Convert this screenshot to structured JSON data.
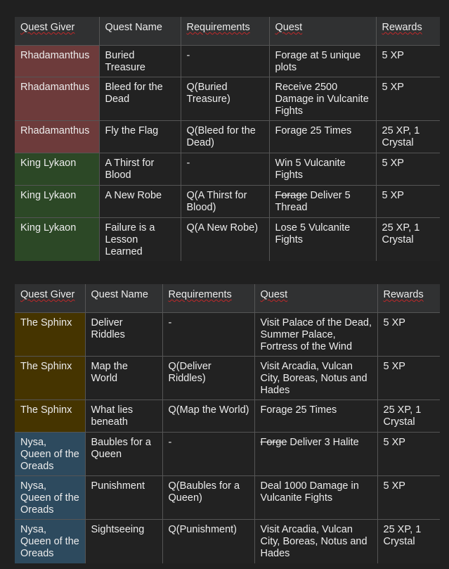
{
  "tables": [
    {
      "headers": [
        "Quest Giver",
        "Quest Name",
        "Requirements",
        "Quest",
        "Rewards"
      ],
      "rows": [
        {
          "giver": "Rhadamanthus",
          "color": "#6d3b3b",
          "name": "Buried Treasure",
          "requirements": "-",
          "quest": "Forage at 5 unique plots",
          "quest_struck": "",
          "rewards": "5 XP"
        },
        {
          "giver": "Rhadamanthus",
          "color": "#6d3b3b",
          "name": "Bleed for the Dead",
          "requirements": "Q(Buried Treasure)",
          "quest": "Receive 2500 Damage in Vulcanite Fights",
          "quest_struck": "",
          "rewards": "5 XP"
        },
        {
          "giver": "Rhadamanthus",
          "color": "#6d3b3b",
          "name": "Fly the Flag",
          "requirements": "Q(Bleed for the Dead)",
          "quest": "Forage 25 Times",
          "quest_struck": "",
          "rewards": "25 XP, 1 Crystal"
        },
        {
          "giver": "King Lykaon",
          "color": "#2c4826",
          "name": "A Thirst for Blood",
          "requirements": "-",
          "quest": "Win 5 Vulcanite Fights",
          "quest_struck": "",
          "rewards": "5 XP"
        },
        {
          "giver": "King Lykaon",
          "color": "#2c4826",
          "name": "A New Robe",
          "requirements": "Q(A Thirst for Blood)",
          "quest": "Deliver 5 Thread",
          "quest_struck": "Forage",
          "rewards": "5 XP"
        },
        {
          "giver": "King Lykaon",
          "color": "#2c4826",
          "name": "Failure is a Lesson Learned",
          "requirements": "Q(A New Robe)",
          "quest": "Lose 5 Vulcanite Fights",
          "quest_struck": "",
          "rewards": "25 XP, 1 Crystal"
        }
      ]
    },
    {
      "headers": [
        "Quest Giver",
        "Quest Name",
        "Requirements",
        "Quest",
        "Rewards"
      ],
      "rows": [
        {
          "giver": "The Sphinx",
          "color": "#453400",
          "name": "Deliver Riddles",
          "requirements": "-",
          "quest": "Visit Palace of the Dead, Summer Palace, Fortress of the Wind",
          "quest_struck": "",
          "rewards": "5 XP"
        },
        {
          "giver": "The Sphinx",
          "color": "#453400",
          "name": "Map the World",
          "requirements": "Q(Deliver Riddles)",
          "quest": "Visit Arcadia, Vulcan City, Boreas, Notus and Hades",
          "quest_struck": "",
          "rewards": "5 XP"
        },
        {
          "giver": "The Sphinx",
          "color": "#453400",
          "name": "What lies beneath",
          "requirements": "Q(Map the World)",
          "quest": "Forage 25 Times",
          "quest_struck": "",
          "rewards": "25 XP, 1 Crystal"
        },
        {
          "giver": "Nysa, Queen of the Oreads",
          "color": "#2d4a5e",
          "name": "Baubles for a Queen",
          "requirements": "-",
          "quest": "Deliver 3 Halite",
          "quest_struck": "Forge",
          "rewards": "5 XP"
        },
        {
          "giver": "Nysa, Queen of the Oreads",
          "color": "#2d4a5e",
          "name": "Punishment",
          "requirements": "Q(Baubles for a Queen)",
          "quest": "Deal 1000 Damage in Vulcanite Fights",
          "quest_struck": "",
          "rewards": "5 XP"
        },
        {
          "giver": "Nysa, Queen of the Oreads",
          "color": "#2d4a5e",
          "name": "Sightseeing",
          "requirements": "Q(Punishment)",
          "quest": "Visit Arcadia, Vulcan City, Boreas, Notus and Hades",
          "quest_struck": "",
          "rewards": "25 XP, 1 Crystal"
        }
      ]
    }
  ]
}
